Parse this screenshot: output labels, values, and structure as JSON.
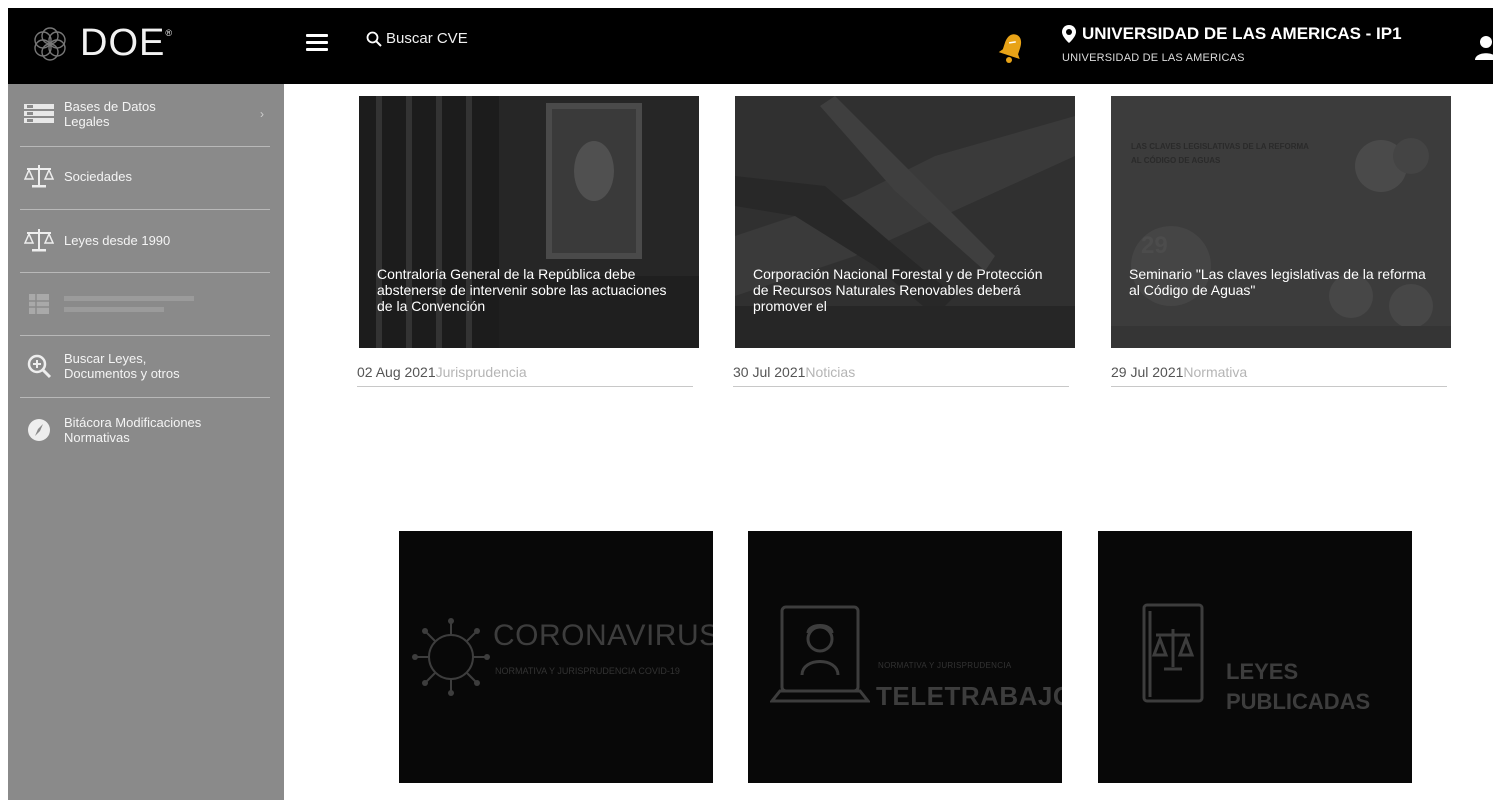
{
  "header": {
    "logo_text": "DOE",
    "logo_sup": "®",
    "search_label": "Buscar CVE",
    "org_name": "UNIVERSIDAD DE LAS AMERICAS - IP1",
    "org_subtitle": "UNIVERSIDAD DE LAS AMERICAS"
  },
  "sidebar": {
    "items": [
      {
        "label": "Bases de Datos Legales",
        "icon": "database-icon"
      },
      {
        "label": "Sociedades",
        "icon": "scales-icon"
      },
      {
        "label": "Leyes desde 1990",
        "icon": "scales-icon"
      },
      {
        "label": "",
        "icon": "grid-icon"
      },
      {
        "label": "Buscar Leyes, Documentos y otros",
        "icon": "search-plus-icon"
      },
      {
        "label": "Bitácora Modificaciones Normativas",
        "icon": "compass-icon"
      }
    ]
  },
  "news": [
    {
      "title": "Contraloría General de la República debe abstenerse de intervenir sobre las actuaciones de la Convención",
      "date": "02 Aug 2021",
      "category": "Jurisprudencia"
    },
    {
      "title": "Corporación Nacional Forestal y de Protección de Recursos Naturales Renovables deberá promover el",
      "date": "30 Jul 2021",
      "category": "Noticias"
    },
    {
      "title": "Seminario \"Las claves legislativas de la reforma al Código de Aguas\"",
      "date": "29 Jul 2021",
      "category": "Normativa"
    }
  ],
  "news_image_texts": {
    "seminar_heading": "LAS CLAVES LEGISLATIVAS DE LA REFORMA AL CÓDIGO DE AGUAS",
    "seminar_number": "29"
  },
  "promos": [
    {
      "title": "CORONAVIRUS",
      "subtitle": "NORMATIVA Y JURISPRUDENCIA COVID-19",
      "icon": "virus-icon"
    },
    {
      "title": "TELETRABAJO",
      "subtitle": "NORMATIVA Y JURISPRUDENCIA",
      "icon": "laptop-user-icon"
    },
    {
      "title": "LEYES",
      "title2": "PUBLICADAS",
      "icon": "law-book-icon"
    }
  ],
  "colors": {
    "topbar": "#000000",
    "sidebar": "#8a8a8a",
    "bell": "#e8a317"
  }
}
